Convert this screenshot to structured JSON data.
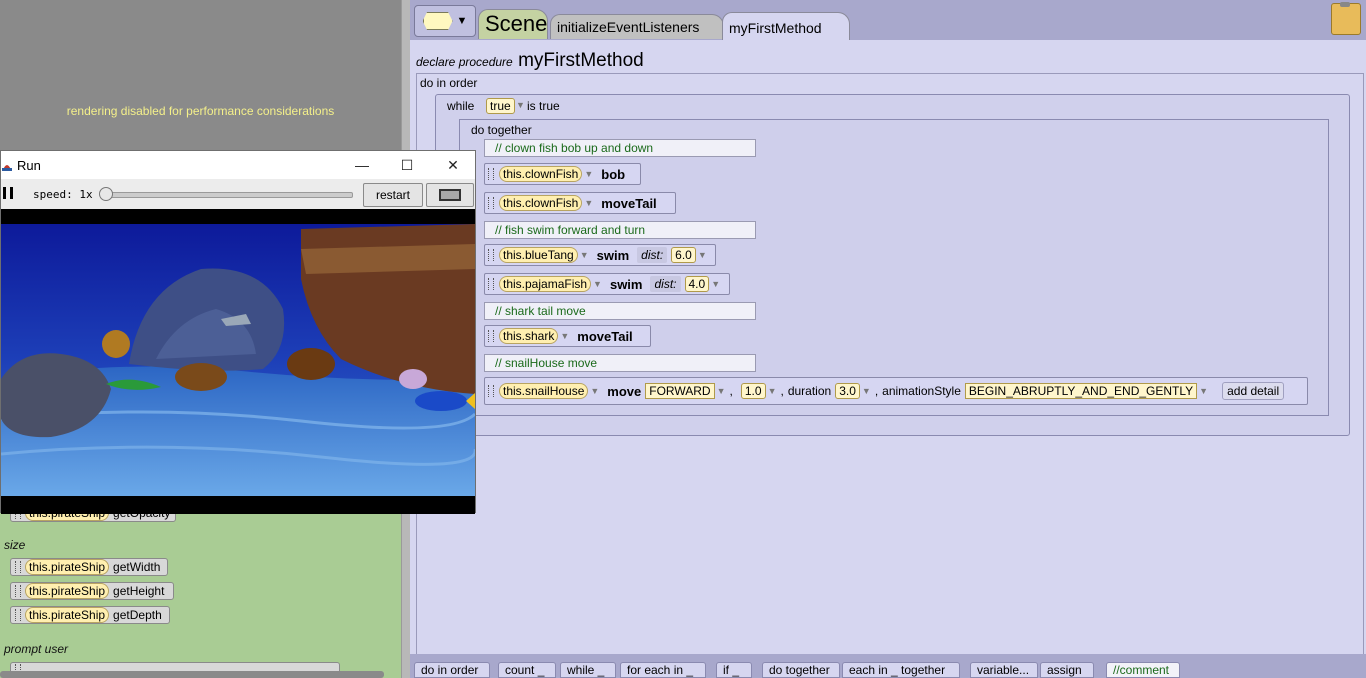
{
  "left_panel": {
    "render_message": "rendering disabled for performance considerations",
    "gallery": {
      "partial_item": {
        "object": "this.pirateShip",
        "method": "getOpacity"
      },
      "size_label": "size",
      "size_items": [
        {
          "object": "this.pirateShip",
          "method": "getWidth"
        },
        {
          "object": "this.pirateShip",
          "method": "getHeight"
        },
        {
          "object": "this.pirateShip",
          "method": "getDepth"
        }
      ],
      "prompt_label": "prompt user"
    }
  },
  "run_window": {
    "title": "Run",
    "speed_label": "speed: 1x",
    "speed_value": 1,
    "restart_label": "restart",
    "minimize_glyph": "—",
    "maximize_glyph": "☐",
    "close_glyph": "✕"
  },
  "editor": {
    "tabs": {
      "scene": "Scene",
      "init": "initializeEventListeners",
      "first": "myFirstMethod"
    },
    "dropdown_glyph": "▼",
    "declaration": {
      "keyword": "declare procedure",
      "name": "myFirstMethod"
    },
    "do_in_order": "do in order",
    "while": {
      "label": "while",
      "condition": "true",
      "suffix": "is true"
    },
    "do_together": "do together",
    "statements": {
      "c1": "// clown fish bob up and down",
      "s1": {
        "object": "this.clownFish",
        "method": "bob"
      },
      "s2": {
        "object": "this.clownFish",
        "method": "moveTail"
      },
      "c2": "// fish swim forward and turn",
      "s3": {
        "object": "this.blueTang",
        "method": "swim",
        "param": "dist:",
        "value": "6.0"
      },
      "s4": {
        "object": "this.pajamaFish",
        "method": "swim",
        "param": "dist:",
        "value": "4.0"
      },
      "c3": "// shark tail move",
      "s5": {
        "object": "this.shark",
        "method": "moveTail"
      },
      "c4": "// snailHouse move",
      "s6": {
        "object": "this.snailHouse",
        "method": "move",
        "direction": "FORWARD",
        "amount": "1.0",
        "duration_label": "duration",
        "duration": "3.0",
        "style_label": "animationStyle",
        "style": "BEGIN_ABRUPTLY_AND_END_GENTLY",
        "add_detail": "add detail"
      }
    }
  },
  "palette": {
    "do_in_order": "do in order",
    "count": "count _",
    "while": "while _",
    "for_each": "for each in _",
    "if": "if _",
    "do_together": "do together",
    "each_together": "each in _ together",
    "variable": "variable...",
    "assign": "assign",
    "comment": "//comment"
  },
  "colors": {
    "editor_bg": "#a8a8cc",
    "workspace_bg": "#d6d6f0",
    "gallery_bg": "#a9cc94",
    "comment_text": "#1a6a1a",
    "object_tile": "#ffefb0",
    "ocean_deep": "#0d1a9a",
    "ocean_floor": "#3a7ad0"
  }
}
